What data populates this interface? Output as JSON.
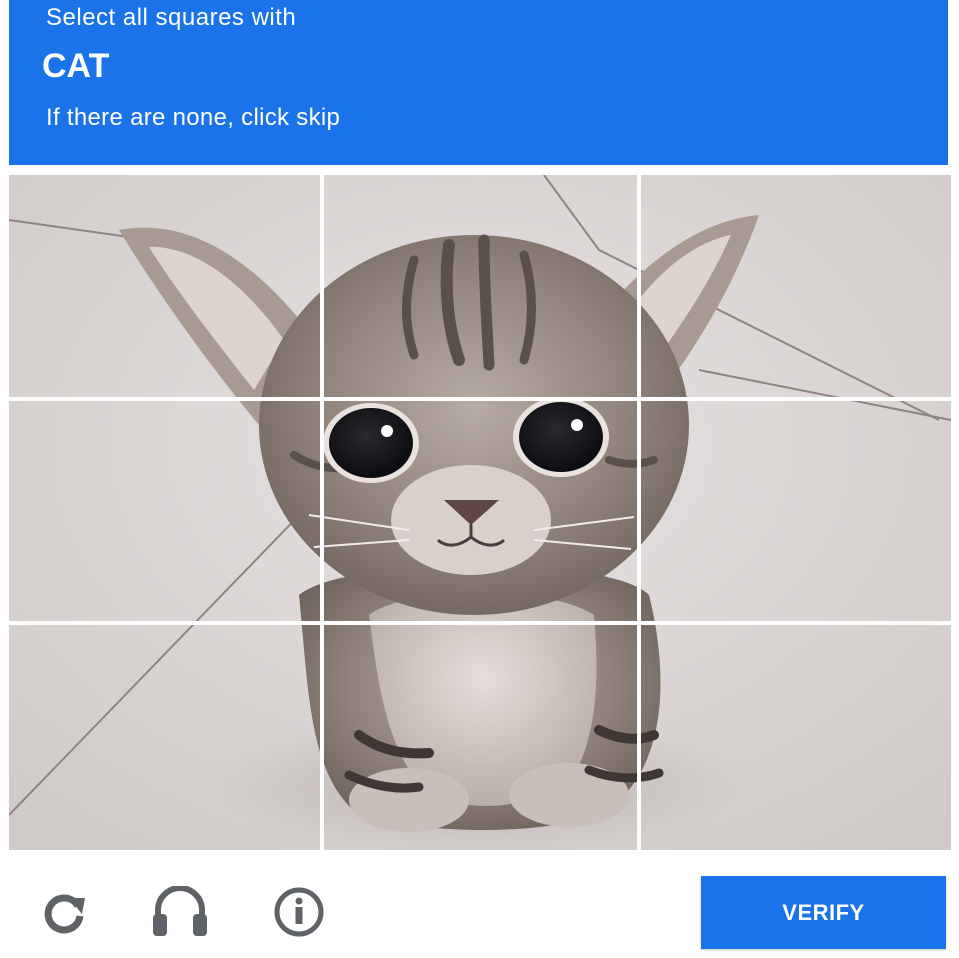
{
  "header": {
    "instruction": "Select all squares with",
    "keyword": "CAT",
    "subtext": "If there are none, click skip"
  },
  "grid": {
    "rows": 3,
    "columns": 3,
    "image_subject": "tabby kitten sitting on white floor tiles",
    "tiles": [
      {
        "row": 1,
        "col": 1,
        "selected": false
      },
      {
        "row": 1,
        "col": 2,
        "selected": false
      },
      {
        "row": 1,
        "col": 3,
        "selected": false
      },
      {
        "row": 2,
        "col": 1,
        "selected": false
      },
      {
        "row": 2,
        "col": 2,
        "selected": false
      },
      {
        "row": 2,
        "col": 3,
        "selected": false
      },
      {
        "row": 3,
        "col": 1,
        "selected": false
      },
      {
        "row": 3,
        "col": 2,
        "selected": false
      },
      {
        "row": 3,
        "col": 3,
        "selected": false
      }
    ]
  },
  "footer": {
    "icons": [
      "reload-icon",
      "audio-icon",
      "info-icon"
    ],
    "verify_label": "VERIFY"
  },
  "colors": {
    "accent": "#1a73e8",
    "icon_gray": "#5f6368",
    "background": "#ffffff"
  }
}
